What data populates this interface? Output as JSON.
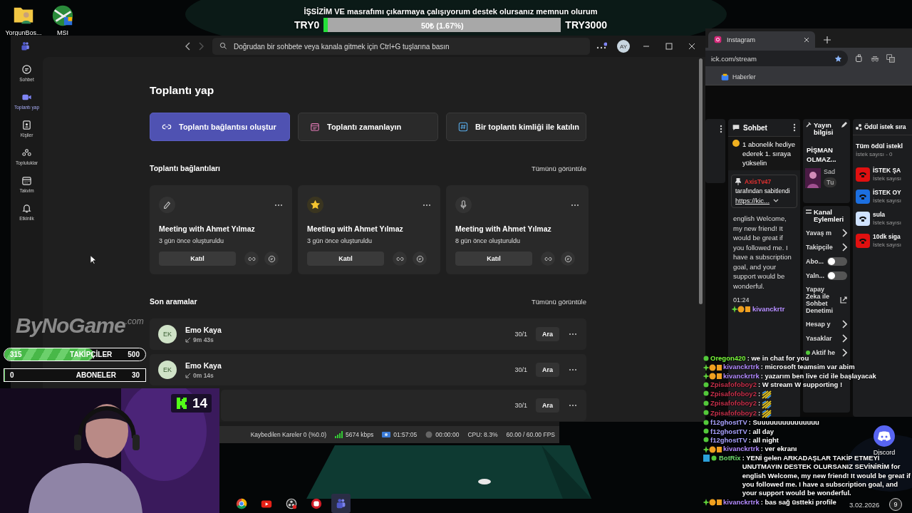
{
  "desktop": {
    "icons": [
      {
        "label": "YorgunBos...",
        "kind": "folder"
      },
      {
        "label": "MSI",
        "kind": "msi"
      },
      {
        "label": "Discord",
        "kind": "discord"
      }
    ]
  },
  "donation": {
    "title": "İŞSİZİM VE masrafımı çıkarmaya çalışıyorum destek olursanız memnun olurum",
    "level": 0.0167,
    "amount": "50₺ (1.67%)",
    "min": "TRY0",
    "max": "TRY3000"
  },
  "teams": {
    "search": {
      "placeholder": "Doğrudan bir sohbete veya kanala gitmek için Ctrl+G tuşlarına basın"
    },
    "avatar": "AY",
    "rail": [
      {
        "label": "Sohbet",
        "kind": "chat",
        "selected": false
      },
      {
        "label": "Toplantı yap",
        "kind": "video",
        "selected": true
      },
      {
        "label": "Kişiler",
        "kind": "contacts",
        "selected": false
      },
      {
        "label": "Topluluklar",
        "kind": "communities",
        "selected": false
      },
      {
        "label": "Takvim",
        "kind": "calendar",
        "selected": false
      },
      {
        "label": "Etkinlik",
        "kind": "bell",
        "selected": false
      }
    ],
    "title": "Toplantı yap",
    "actions": [
      {
        "label": "Toplantı bağlantısı oluştur",
        "kind": "link",
        "primary": true
      },
      {
        "label": "Toplantı zamanlayın",
        "kind": "calendar",
        "primary": false
      },
      {
        "label": "Bir toplantı kimliği ile katılın",
        "kind": "hash",
        "primary": false
      }
    ],
    "links": {
      "heading": "Toplantı bağlantıları",
      "view_all": "Tümünü görüntüle",
      "cards": [
        {
          "kind": "pen",
          "title": "Meeting with Ahmet Yılmaz",
          "subtitle": "3 gün önce oluşturuldu",
          "button": "Katıl"
        },
        {
          "kind": "star",
          "title": "Meeting with Ahmet Yılmaz",
          "subtitle": "3 gün önce oluşturuldu",
          "button": "Katıl"
        },
        {
          "kind": "mic",
          "title": "Meeting with Ahmet Yılmaz",
          "subtitle": "8 gün önce oluşturuldu",
          "button": "Katıl"
        }
      ]
    },
    "recent": {
      "heading": "Son aramalar",
      "view_all": "Tümünü görüntüle",
      "rows": [
        {
          "initials": "EK",
          "name": "Emo Kaya",
          "duration": "9m 43s",
          "date": "30/1",
          "button": "Ara"
        },
        {
          "initials": "EK",
          "name": "Emo Kaya",
          "duration": "0m 14s",
          "date": "30/1",
          "button": "Ara"
        },
        {
          "date": "30/1",
          "button": "Ara"
        }
      ]
    }
  },
  "stream_overlay": {
    "logo": {
      "name": "ByNoGame",
      "suffix": ".com"
    },
    "goals": [
      {
        "count": "315",
        "label": "TAKİPÇİLER",
        "target": "500",
        "level": 0.63
      },
      {
        "count": "0",
        "label": "ABONELER",
        "target": "30",
        "level": 0
      }
    ],
    "viewers": "14"
  },
  "obs_status": [
    {
      "kind": "text",
      "text": "Kaybedilen Kareler 0 (%0.0)"
    },
    {
      "kind": "bitrate",
      "text": "5674 kbps"
    },
    {
      "kind": "stream",
      "text": "01:57:05"
    },
    {
      "kind": "record",
      "text": "00:00:00"
    },
    {
      "kind": "text",
      "text": "CPU: 8.3%"
    },
    {
      "kind": "text",
      "text": "60.00 / 60.00 FPS"
    }
  ],
  "taskbar": {
    "apps": [
      {
        "kind": "chrome",
        "selected": false
      },
      {
        "kind": "youtube",
        "selected": false
      },
      {
        "kind": "obs",
        "selected": false
      },
      {
        "kind": "red",
        "selected": false
      },
      {
        "kind": "teams",
        "selected": true
      }
    ],
    "date": "3.02.2026",
    "notifications": "9"
  },
  "browser": {
    "tab": "Instagram",
    "url": "ick.com/stream",
    "bookmark": "Haberler",
    "chat": {
      "title": "Sohbet",
      "gift": "1 abonelik hediye ederek 1. sıraya yükselin",
      "pin_user": "AxisTv47",
      "pin_text": "tarafından sabitlendi",
      "pin_link": "https://kic...",
      "message": "english Welcome, my new friend! It would be great if you followed me. I have a subscription goal, and your support would be wonderful.",
      "time": "01:24",
      "user": "kivanckrtr"
    },
    "stream_info": {
      "title": "Yayın bilgisi",
      "name": "PİŞMAN OLMAZ...",
      "category": "Sad",
      "tag": "Tu"
    },
    "actions": {
      "title": "Kanal Eylemleri",
      "items": [
        {
          "label": "Yavaş m",
          "kind": "link"
        },
        {
          "label": "Takipçile",
          "kind": "link"
        },
        {
          "label": "Abo...",
          "kind": "toggle",
          "on": false
        },
        {
          "label": "Yaln...",
          "kind": "toggle",
          "on": false
        },
        {
          "label": "Yapay Zeka ile Sohbet Denetimi",
          "kind": "external"
        },
        {
          "label": "Hesap y",
          "kind": "link"
        },
        {
          "label": "Yasaklar",
          "kind": "link"
        },
        {
          "label": "Aktif he",
          "kind": "status"
        }
      ]
    },
    "rewards": {
      "title": "Ödül istek sıra",
      "all": "Tüm ödül istekl",
      "count": "İstek sayısı - 0",
      "items": [
        {
          "name": "İSTEK ŞA",
          "sub": "İstek sayısı",
          "color": "#e01010"
        },
        {
          "name": "İSTEK OY",
          "sub": "İstek sayısı",
          "color": "#1c6fe0"
        },
        {
          "name": "sula",
          "sub": "İstek sayısı",
          "color": "#cfe2ff"
        },
        {
          "name": "10dk siga",
          "sub": "İstek sayısı",
          "color": "#e01010"
        }
      ]
    }
  },
  "chat_overlay": {
    "messages": [
      {
        "user": "Oregon420",
        "color": "#7cff3c",
        "kind": "dot",
        "text": ": we in chat for you"
      },
      {
        "user": "kivanckrtrk",
        "color": "#b48cff",
        "kind": "sub",
        "text": ": microsoft teamsim var abim"
      },
      {
        "user": "kivanckrtrk",
        "color": "#b48cff",
        "kind": "sub",
        "text": ": yazarım ben live cid ile başlayacak"
      },
      {
        "user": "Zpisafofoboy2",
        "color": "#c8314c",
        "kind": "dot",
        "text": ": W stream W supporting !"
      },
      {
        "user": "Zpisafofoboy2",
        "color": "#c8314c",
        "kind": "dot",
        "text": ":",
        "emote": true
      },
      {
        "user": "Zpisafofoboy2",
        "color": "#c8314c",
        "kind": "dot",
        "text": ":",
        "emote": true
      },
      {
        "user": "Zpisafofoboy2",
        "color": "#c8314c",
        "kind": "dot",
        "text": ":",
        "emote": true
      },
      {
        "user": "f12ghostTV",
        "color": "#a9a2ff",
        "kind": "dot",
        "text": ": Suuuuuuuuuuuuuuu"
      },
      {
        "user": "f12ghostTV",
        "color": "#a9a2ff",
        "kind": "dot",
        "text": ": all day"
      },
      {
        "user": "f12ghostTV",
        "color": "#a9a2ff",
        "kind": "dot",
        "text": ": all night"
      },
      {
        "user": "kivanckrtrk",
        "color": "#b48cff",
        "kind": "sub",
        "text": ": ver ekranı"
      },
      {
        "user": "BotRix",
        "color": "#6fdc6f",
        "kind": "bot",
        "text": ": YENİ gelen ARKADAŞLAR TAKİP ETMEYİ UNUTMAYIN DESTEK OLURSANIZ SEVİNİRİM for english Welcome, my new friend! It would be great if you followed me. I have a subscription goal, and your support would be wonderful."
      },
      {
        "user": "kivanckrtrk",
        "color": "#b48cff",
        "kind": "sub",
        "text": ": bas sağ üstteki profile"
      }
    ]
  }
}
